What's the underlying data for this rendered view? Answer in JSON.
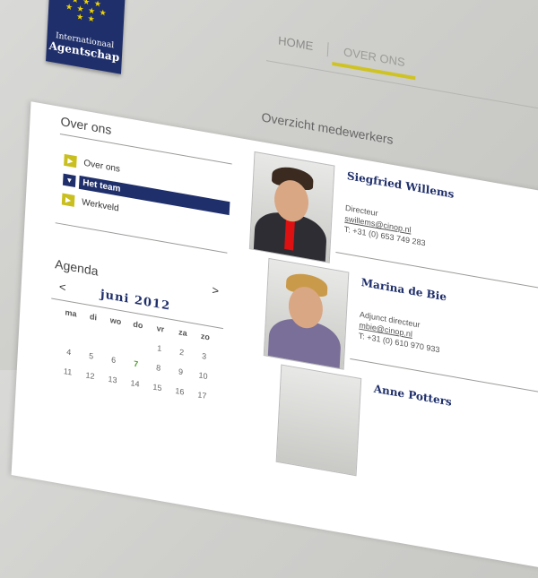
{
  "logo": {
    "line1": "Internationaal",
    "line2": "Agentschap"
  },
  "nav": {
    "home": "HOME",
    "over_ons": "OVER ONS"
  },
  "page_title": "Overzicht medewerkers",
  "sidebar": {
    "title": "Over ons",
    "items": [
      {
        "label": "Over ons",
        "selected": false
      },
      {
        "label": "Het team",
        "selected": true
      },
      {
        "label": "Werkveld",
        "selected": false
      }
    ]
  },
  "agenda": {
    "title": "Agenda",
    "month": "juni 2012",
    "prev": "<",
    "next": ">",
    "days": [
      "ma",
      "di",
      "wo",
      "do",
      "vr",
      "za",
      "zo"
    ],
    "weeks": [
      [
        "",
        "",
        "",
        "",
        "1",
        "2",
        "3"
      ],
      [
        "4",
        "5",
        "6",
        "7",
        "8",
        "9",
        "10"
      ],
      [
        "11",
        "12",
        "13",
        "14",
        "15",
        "16",
        "17"
      ]
    ],
    "today": "7"
  },
  "staff": [
    {
      "name": "Siegfried Willems",
      "role": "Directeur",
      "email": "swillems@cinop.nl",
      "tel": "T: +31 (0) 653 749 283"
    },
    {
      "name": "Marina de Bie",
      "role": "Adjunct directeur",
      "email": "mbie@cinop.nl",
      "tel": "T: +31 (0) 610 970 933"
    },
    {
      "name": "Anne Potters",
      "role": "",
      "email": "",
      "tel": ""
    }
  ],
  "colors": {
    "navy": "#1f2f6b",
    "accent": "#c9bf1f",
    "today": "#4aa02c"
  }
}
